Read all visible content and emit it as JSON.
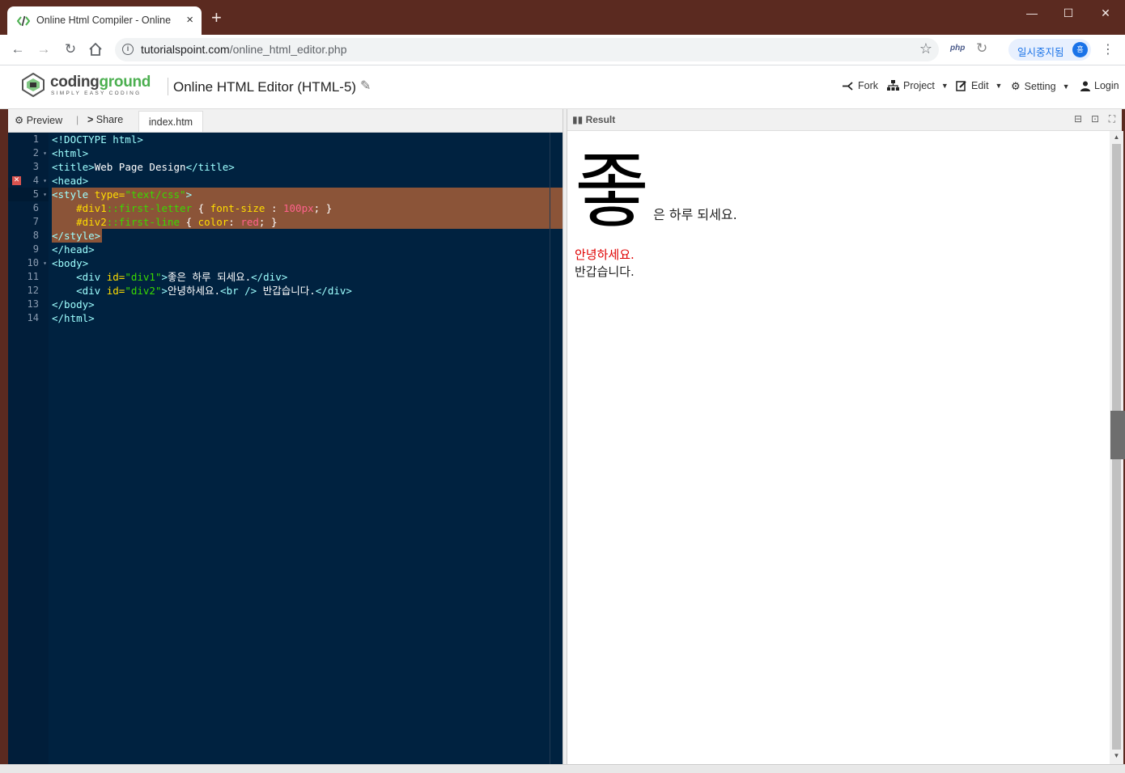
{
  "browser": {
    "tab_title": "Online Html Compiler - Online H",
    "tab_close": "×",
    "new_tab": "+",
    "url_host": "tutorialspoint.com",
    "url_path": "/online_html_editor.php",
    "ext_php": "php",
    "paused_label": "일시중지됨",
    "paused_avatar": "흠",
    "window": {
      "minimize": "—",
      "maximize": "☐",
      "close": "✕"
    }
  },
  "site": {
    "logo_main": "coding",
    "logo_accent": "ground",
    "logo_sub": "SIMPLY EASY CODING",
    "editor_title": "Online HTML Editor (HTML-5)",
    "menu": [
      {
        "label": "Fork"
      },
      {
        "label": "Project"
      },
      {
        "label": "Edit"
      },
      {
        "label": "Setting"
      },
      {
        "label": "Login"
      }
    ]
  },
  "left_toolbar": {
    "preview": "Preview",
    "separator": "|",
    "share": "Share",
    "file_tab": "index.htm"
  },
  "editor": {
    "line_numbers": [
      "1",
      "2",
      "3",
      "4",
      "5",
      "6",
      "7",
      "8",
      "9",
      "10",
      "11",
      "12",
      "13",
      "14"
    ]
  },
  "right_toolbar": {
    "result_label": "Result"
  },
  "result": {
    "div1_first_letter": "좋",
    "div1_rest": "은 하루 되세요.",
    "div2_first_line": "안녕하세요.",
    "div2_second_line": "반갑습니다."
  }
}
